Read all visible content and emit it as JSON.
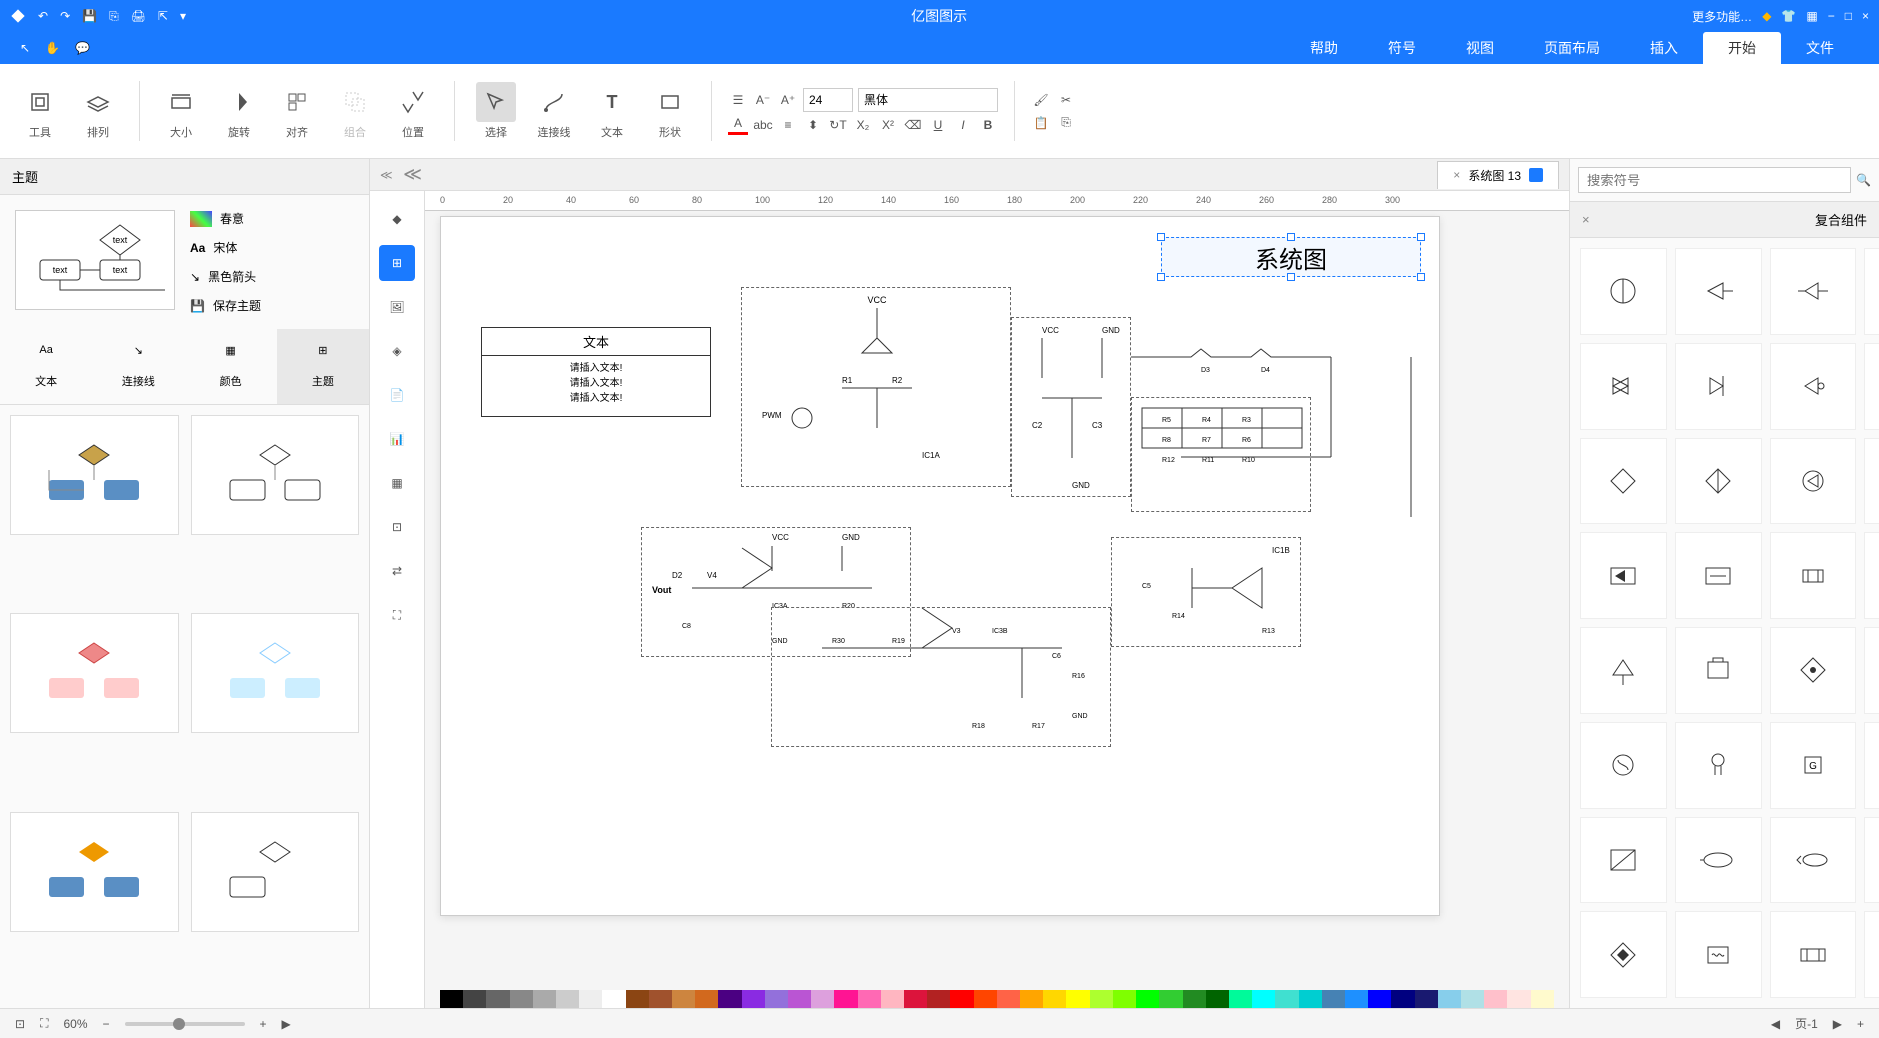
{
  "app": {
    "title": "亿图图示",
    "window_controls": [
      "−",
      "□",
      "×"
    ]
  },
  "menu": {
    "tabs": [
      "文件",
      "开始",
      "插入",
      "页面布局",
      "视图",
      "符号",
      "帮助"
    ],
    "active": "开始",
    "extra_label": "更多功能…"
  },
  "ribbon": {
    "font_name": "黑体",
    "font_size": "24",
    "groups": {
      "shape": "形状",
      "text": "文本",
      "connector": "连接线",
      "select": "选择",
      "position": "位置",
      "combine": "组合",
      "align": "对齐",
      "rotate": "旋转",
      "size": "大小",
      "layer": "排列",
      "tools": "工具"
    }
  },
  "doc_tab": {
    "name": "系统图 13"
  },
  "left_panel": {
    "title": "主题",
    "tabs": [
      "主题",
      "颜色",
      "连接线",
      "文本"
    ],
    "options": {
      "opt1": "春意",
      "opt2": "宋体",
      "opt3": "黑色箭头",
      "opt4": "保存主题"
    },
    "preview_text": "text"
  },
  "right_panel": {
    "search_placeholder": "搜索符号",
    "section_title": "复合组件"
  },
  "canvas": {
    "title_text": "系统图",
    "textbox_header": "文本",
    "textbox_line": "请插入文本!",
    "ruler_marks": [
      "0",
      "20",
      "40",
      "60",
      "80",
      "100",
      "120",
      "140",
      "160",
      "180",
      "200",
      "220",
      "240",
      "260",
      "280",
      "300"
    ]
  },
  "statusbar": {
    "page": "页-1",
    "zoom": "60%"
  },
  "colors": [
    "#000",
    "#444",
    "#666",
    "#888",
    "#aaa",
    "#ccc",
    "#eee",
    "#fff",
    "#8b4513",
    "#a0522d",
    "#cd853f",
    "#d2691e",
    "#4b0082",
    "#8a2be2",
    "#9370db",
    "#ba55d3",
    "#dda0dd",
    "#ff1493",
    "#ff69b4",
    "#ffb6c1",
    "#dc143c",
    "#b22222",
    "#ff0000",
    "#ff4500",
    "#ff6347",
    "#ffa500",
    "#ffd700",
    "#ffff00",
    "#adff2f",
    "#7fff00",
    "#00ff00",
    "#32cd32",
    "#228b22",
    "#006400",
    "#00fa9a",
    "#00ffff",
    "#40e0d0",
    "#00ced1",
    "#4682b4",
    "#1e90ff",
    "#0000ff",
    "#000080",
    "#191970",
    "#87ceeb",
    "#b0e0e6",
    "#ffc0cb",
    "#ffe4e1",
    "#fffacd"
  ]
}
